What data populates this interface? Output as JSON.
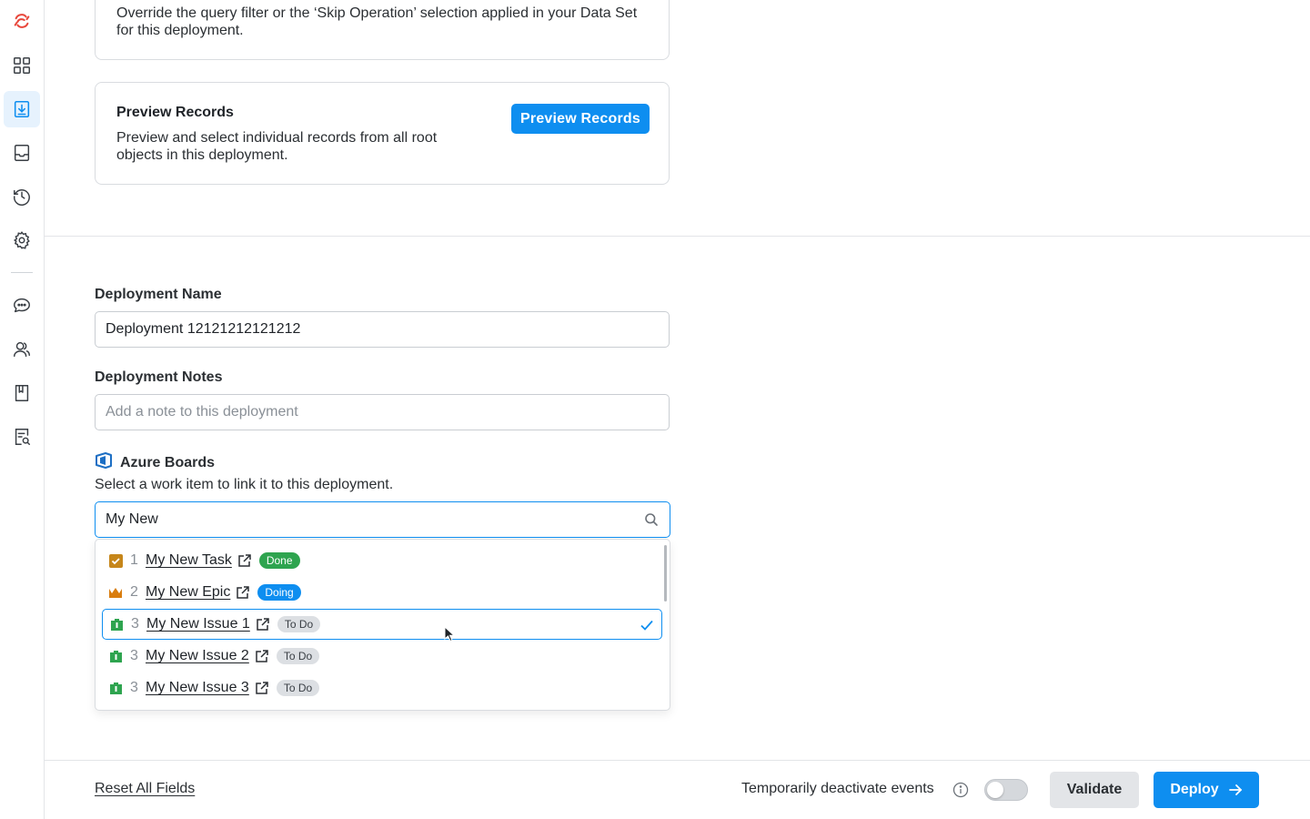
{
  "sidebar": {
    "icons": [
      "logo-icon",
      "dashboard-icon",
      "deploy-icon",
      "inbox-icon",
      "history-icon",
      "settings-icon",
      "chat-icon",
      "users-icon",
      "book-icon",
      "search-document-icon"
    ],
    "active": "deploy-icon",
    "accent": "#e8473b"
  },
  "filter_card": {
    "description": "Override the query filter or the ‘Skip Operation’ selection applied in your Data Set for this deployment."
  },
  "preview_card": {
    "title": "Preview Records",
    "description": "Preview and select individual records from all root objects in this deployment.",
    "button_label": "Preview Records"
  },
  "deployment_name": {
    "label": "Deployment Name",
    "value": "Deployment 12121212121212"
  },
  "deployment_notes": {
    "label": "Deployment Notes",
    "placeholder": "Add a note to this deployment"
  },
  "azure": {
    "title": "Azure Boards",
    "description": "Select a work item to link it to this deployment.",
    "search_value": "My New",
    "items": [
      {
        "icon": "task-icon",
        "id": "1",
        "title": "My New Task",
        "status": "Done",
        "status_type": "done",
        "selected": false
      },
      {
        "icon": "epic-icon",
        "id": "2",
        "title": "My New Epic",
        "status": "Doing",
        "status_type": "doing",
        "selected": false
      },
      {
        "icon": "issue-icon",
        "id": "3",
        "title": "My New Issue 1",
        "status": "To Do",
        "status_type": "todo",
        "selected": true
      },
      {
        "icon": "issue-icon",
        "id": "3",
        "title": "My New Issue 2",
        "status": "To Do",
        "status_type": "todo",
        "selected": false
      },
      {
        "icon": "issue-icon",
        "id": "3",
        "title": "My New Issue 3",
        "status": "To Do",
        "status_type": "todo",
        "selected": false
      }
    ]
  },
  "footer": {
    "reset_label": "Reset All Fields",
    "deactivate_label": "Temporarily deactivate events",
    "toggle_on": false,
    "validate_label": "Validate",
    "deploy_label": "Deploy"
  },
  "colors": {
    "primary": "#0e8ef0",
    "done": "#2ea44f",
    "todo": "#dcdfe3"
  }
}
